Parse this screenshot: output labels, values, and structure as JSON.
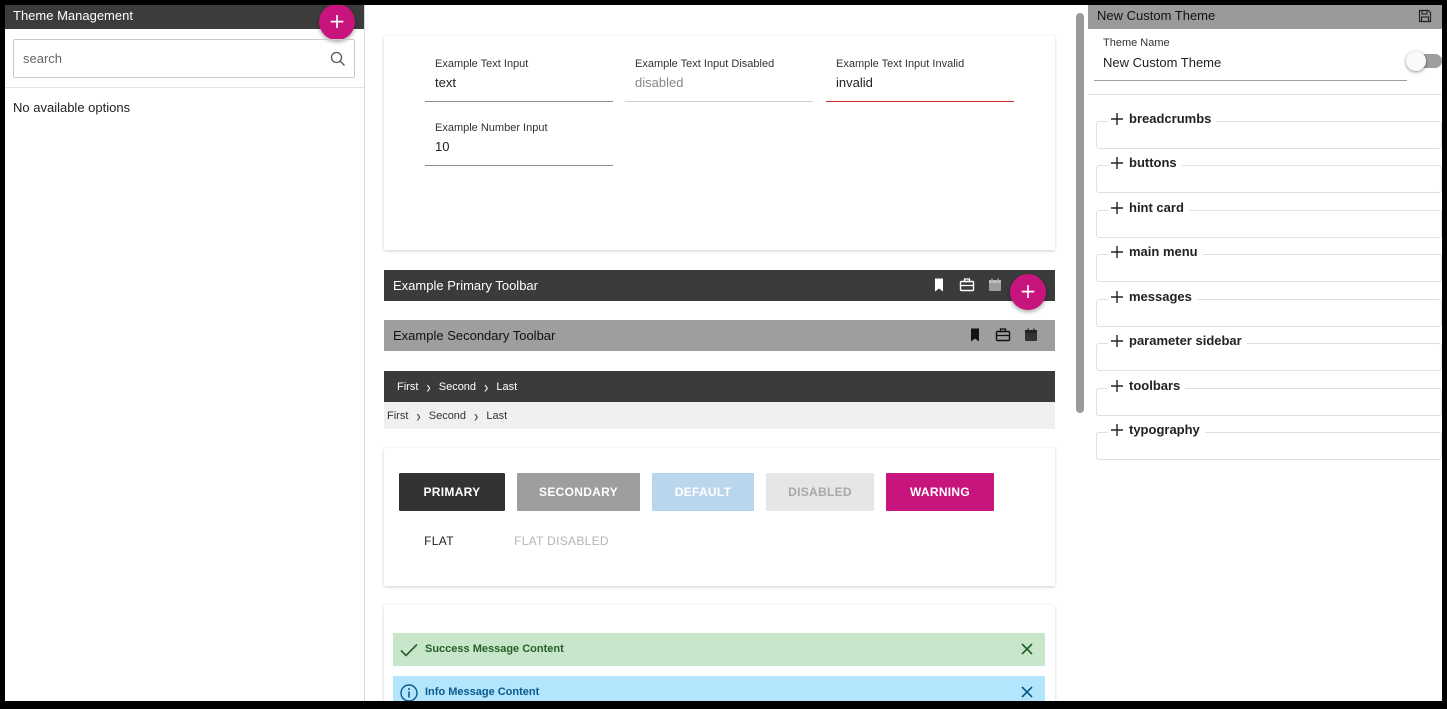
{
  "left_panel": {
    "title": "Theme Management",
    "add_button": "+",
    "search_placeholder": "search",
    "empty_text": "No available options"
  },
  "inputs_card": {
    "text_input": {
      "label": "Example Text Input",
      "value": "text"
    },
    "disabled_input": {
      "label": "Example Text Input Disabled",
      "value": "disabled"
    },
    "invalid_input": {
      "label": "Example Text Input Invalid",
      "value": "invalid"
    },
    "number_input": {
      "label": "Example Number Input",
      "value": "10"
    }
  },
  "toolbars": {
    "primary_title": "Example Primary Toolbar",
    "secondary_title": "Example Secondary Toolbar",
    "fab": "+",
    "icons": [
      "bookmark-icon",
      "briefcase-icon",
      "calendar-icon"
    ]
  },
  "breadcrumbs": {
    "items": [
      "First",
      "Second",
      "Last"
    ]
  },
  "buttons": {
    "primary": "PRIMARY",
    "secondary": "SECONDARY",
    "default": "DEFAULT",
    "disabled": "DISABLED",
    "warning": "WARNING",
    "flat": "FLAT",
    "flat_disabled": "FLAT DISABLED"
  },
  "messages": {
    "success": "Success Message Content",
    "info": "Info Message Content"
  },
  "right_panel": {
    "title": "New Custom Theme",
    "theme_name_label": "Theme Name",
    "theme_name_value": "New Custom Theme",
    "sections": [
      "breadcrumbs",
      "buttons",
      "hint card",
      "main menu",
      "messages",
      "parameter sidebar",
      "toolbars",
      "typography"
    ]
  },
  "colors": {
    "accent": "#c7157d",
    "toolbar_primary": "#3b3b3b",
    "toolbar_secondary": "#9e9e9e",
    "success_bg": "#c8e6c9",
    "info_bg": "#b3e5fc",
    "invalid": "#d32f2f"
  }
}
